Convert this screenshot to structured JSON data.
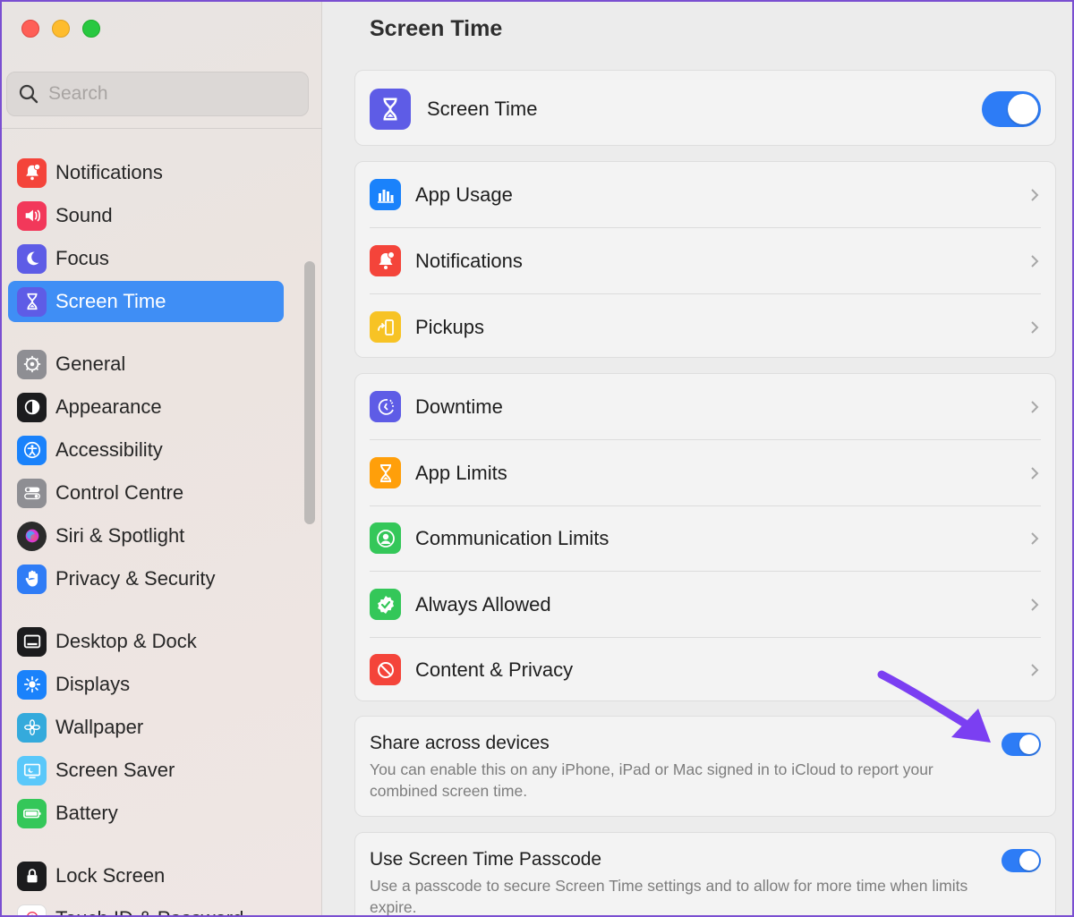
{
  "sidebar": {
    "search_placeholder": "Search",
    "items": [
      {
        "label": "Notifications",
        "icon": "notifications-icon",
        "color": "#f4443a"
      },
      {
        "label": "Sound",
        "icon": "speaker-icon",
        "color": "#f2385a"
      },
      {
        "label": "Focus",
        "icon": "moon-icon",
        "color": "#5e5ce6"
      },
      {
        "label": "Screen Time",
        "icon": "hourglass-icon",
        "color": "#5e5ce6",
        "selected": true
      },
      {
        "label": "General",
        "icon": "gear-icon",
        "color": "#8e8e93"
      },
      {
        "label": "Appearance",
        "icon": "appearance-icon",
        "color": "#1c1c1e"
      },
      {
        "label": "Accessibility",
        "icon": "accessibility-icon",
        "color": "#1a82fb"
      },
      {
        "label": "Control Centre",
        "icon": "control-centre-icon",
        "color": "#8e8e93"
      },
      {
        "label": "Siri & Spotlight",
        "icon": "siri-icon",
        "color": "#2b2b2b"
      },
      {
        "label": "Privacy & Security",
        "icon": "hand-icon",
        "color": "#2f7cf6"
      },
      {
        "label": "Desktop & Dock",
        "icon": "dock-icon",
        "color": "#1c1c1e"
      },
      {
        "label": "Displays",
        "icon": "sun-icon",
        "color": "#1a82fb"
      },
      {
        "label": "Wallpaper",
        "icon": "flower-icon",
        "color": "#34aadc"
      },
      {
        "label": "Screen Saver",
        "icon": "screen-saver-icon",
        "color": "#5ac8fa"
      },
      {
        "label": "Battery",
        "icon": "battery-icon",
        "color": "#34c759"
      },
      {
        "label": "Lock Screen",
        "icon": "lock-icon",
        "color": "#1c1c1e"
      },
      {
        "label": "Touch ID & Password",
        "icon": "fingerprint-icon",
        "color": "#ffffff"
      }
    ]
  },
  "main": {
    "title": "Screen Time",
    "master": {
      "label": "Screen Time",
      "enabled": true
    },
    "group1": [
      {
        "label": "App Usage",
        "icon": "chart-icon",
        "color": "#1a82fb"
      },
      {
        "label": "Notifications",
        "icon": "notifications-icon",
        "color": "#f4443a"
      },
      {
        "label": "Pickups",
        "icon": "pickups-icon",
        "color": "#f7c325"
      }
    ],
    "group2": [
      {
        "label": "Downtime",
        "icon": "downtime-icon",
        "color": "#5e5ce6"
      },
      {
        "label": "App Limits",
        "icon": "hourglass-icon",
        "color": "#ff9f0a"
      },
      {
        "label": "Communication Limits",
        "icon": "person-icon",
        "color": "#34c759"
      },
      {
        "label": "Always Allowed",
        "icon": "check-badge-icon",
        "color": "#34c759"
      },
      {
        "label": "Content & Privacy",
        "icon": "restricted-icon",
        "color": "#f4443a"
      }
    ],
    "share": {
      "title": "Share across devices",
      "description": "You can enable this on any iPhone, iPad or Mac signed in to iCloud to report your combined screen time.",
      "enabled": true
    },
    "passcode": {
      "title": "Use Screen Time Passcode",
      "description": "Use a passcode to secure Screen Time settings and to allow for more time when limits expire.",
      "enabled": true
    }
  },
  "annotation_color": "#7b3ff2"
}
